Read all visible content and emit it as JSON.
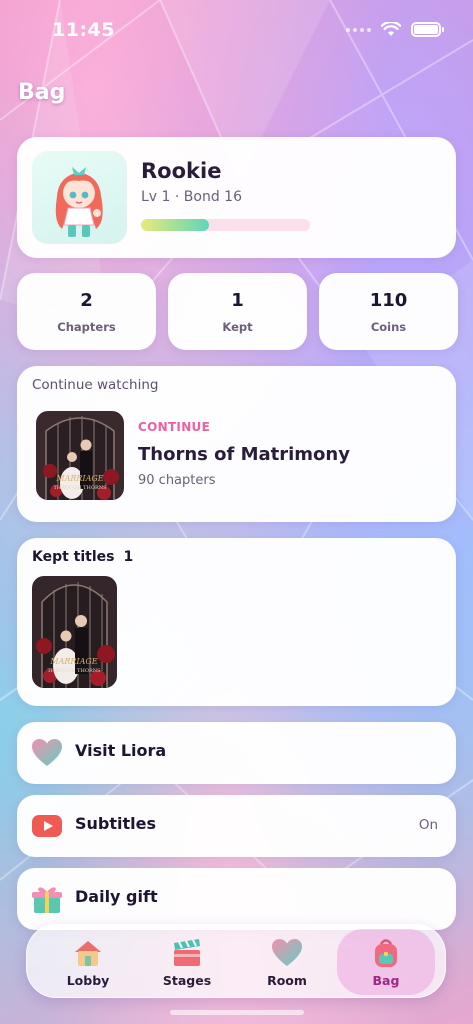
{
  "status_bar": {
    "time": "11:45"
  },
  "header": {
    "title": "Bag"
  },
  "profile": {
    "name": "Rookie",
    "subtitle": "Lv 1 · Bond 16",
    "xp_progress": 0.4
  },
  "stats": [
    {
      "value": "2",
      "label": "Chapters"
    },
    {
      "value": "1",
      "label": "Kept"
    },
    {
      "value": "110",
      "label": "Coins"
    }
  ],
  "continue_watching": {
    "section_label": "Continue watching",
    "tag": "CONTINUE",
    "title": "Thorns of Matrimony",
    "meta": "90 chapters",
    "cover_text": "MARRIAGE THROUGH THORNS"
  },
  "kept_titles": {
    "label": "Kept titles",
    "count": "1",
    "cover_text": "MARRIAGE THROUGH THORNS"
  },
  "rows": [
    {
      "label": "Visit Liora",
      "value": "",
      "icon": "heart-icon"
    },
    {
      "label": "Subtitles",
      "value": "On",
      "icon": "play-icon"
    },
    {
      "label": "Daily gift",
      "value": "",
      "icon": "gift-icon"
    }
  ],
  "nav": [
    {
      "label": "Lobby",
      "icon": "house-icon",
      "active": false
    },
    {
      "label": "Stages",
      "icon": "clapperboard-icon",
      "active": false
    },
    {
      "label": "Room",
      "icon": "heart-icon",
      "active": false
    },
    {
      "label": "Bag",
      "icon": "backpack-icon",
      "active": true
    }
  ],
  "colors": {
    "accent": "#ec5fa0",
    "xp_start": "#e8ea7a",
    "xp_end": "#5fd6b9"
  }
}
